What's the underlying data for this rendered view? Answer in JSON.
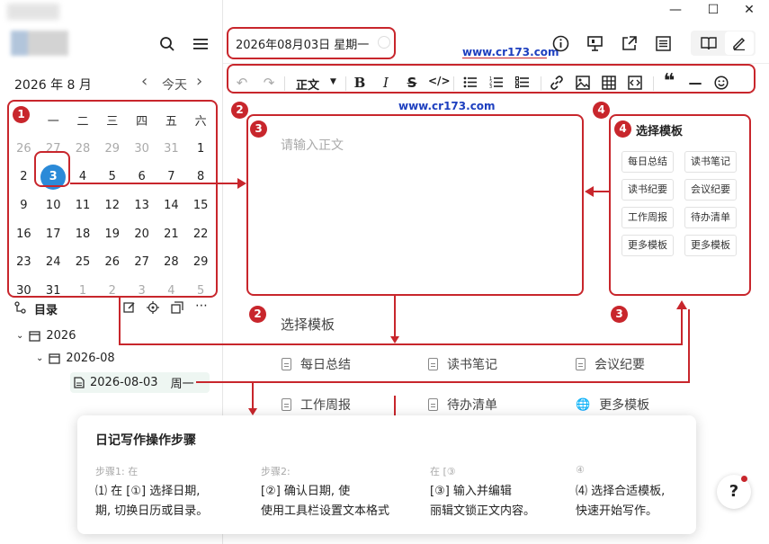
{
  "window": {
    "minimize": "—",
    "maximize": "☐",
    "close": "✕"
  },
  "sidebar": {
    "search_icon": "search-icon",
    "menu_icon": "menu-icon",
    "calendar": {
      "month_title": "2026 年 8 月",
      "prev": "‹",
      "today": "今天",
      "next": "›",
      "weekdays": [
        "一",
        "二",
        "三",
        "四",
        "五",
        "六"
      ],
      "rows": [
        [
          {
            "d": "26",
            "m": true
          },
          {
            "d": "27",
            "m": true
          },
          {
            "d": "28",
            "m": true
          },
          {
            "d": "29",
            "m": true
          },
          {
            "d": "30",
            "m": true
          },
          {
            "d": "31",
            "m": true
          },
          {
            "d": "1",
            "m": false
          }
        ],
        [
          {
            "d": "2",
            "m": false
          },
          {
            "d": "3",
            "m": false,
            "sel": true
          },
          {
            "d": "4",
            "m": false
          },
          {
            "d": "5",
            "m": false
          },
          {
            "d": "6",
            "m": false
          },
          {
            "d": "7",
            "m": false
          },
          {
            "d": "8",
            "m": false
          }
        ],
        [
          {
            "d": "9",
            "m": false
          },
          {
            "d": "10",
            "m": false
          },
          {
            "d": "11",
            "m": false
          },
          {
            "d": "12",
            "m": false
          },
          {
            "d": "13",
            "m": false
          },
          {
            "d": "14",
            "m": false
          },
          {
            "d": "15",
            "m": false
          }
        ],
        [
          {
            "d": "16",
            "m": false
          },
          {
            "d": "17",
            "m": false
          },
          {
            "d": "18",
            "m": false
          },
          {
            "d": "19",
            "m": false
          },
          {
            "d": "20",
            "m": false
          },
          {
            "d": "21",
            "m": false
          },
          {
            "d": "22",
            "m": false
          }
        ],
        [
          {
            "d": "23",
            "m": false
          },
          {
            "d": "24",
            "m": false
          },
          {
            "d": "25",
            "m": false
          },
          {
            "d": "26",
            "m": false
          },
          {
            "d": "27",
            "m": false
          },
          {
            "d": "28",
            "m": false
          },
          {
            "d": "29",
            "m": false
          }
        ],
        [
          {
            "d": "30",
            "m": false
          },
          {
            "d": "31",
            "m": false
          },
          {
            "d": "1",
            "m": true
          },
          {
            "d": "2",
            "m": true
          },
          {
            "d": "3",
            "m": true
          },
          {
            "d": "4",
            "m": true
          },
          {
            "d": "5",
            "m": true
          }
        ]
      ]
    },
    "outline": {
      "label": "目录",
      "items": {
        "year": "2026",
        "month": "2026-08",
        "day": "2026-08-03",
        "weekday": "周一"
      }
    }
  },
  "header": {
    "date_title": "2026年08月03日 星期一",
    "watermark": "www.cr173.com"
  },
  "toolbar": {
    "style_label": "正文"
  },
  "editor": {
    "placeholder": "请输入正文",
    "watermark": "www.cr173.com",
    "choose_template": "选择模板"
  },
  "template_panel": {
    "title": "选择模板",
    "buttons": [
      "每日总结",
      "读书笔记",
      "读书纪要",
      "会议纪要",
      "工作周报",
      "待办清单",
      "更多模板",
      "更多模板"
    ]
  },
  "template_list": {
    "items": [
      "每日总结",
      "读书笔记",
      "会议纪要",
      "工作周报",
      "待办清单",
      "更多模板"
    ]
  },
  "badges": {
    "b1": "1",
    "b2": "2",
    "b3": "3",
    "b4": "4",
    "b2b": "2",
    "b3b": "3",
    "b4b": "4"
  },
  "guide": {
    "title": "日记写作操作步骤",
    "step_labels": [
      "步骤1: 在",
      "步骤2:",
      "在 [③",
      "④"
    ],
    "steps": [
      [
        "⑴ 在 [①] 选择日期,",
        "期, 切换日历或目录。"
      ],
      [
        "[②] 确认日期, 使",
        "使用工具栏设置文本格式"
      ],
      [
        "[③] 输入并编辑",
        "丽辑文锁正文内容。"
      ],
      [
        "⑷ 选择合适模板,",
        "快速开始写作。"
      ]
    ]
  },
  "help": {
    "label": "?"
  }
}
